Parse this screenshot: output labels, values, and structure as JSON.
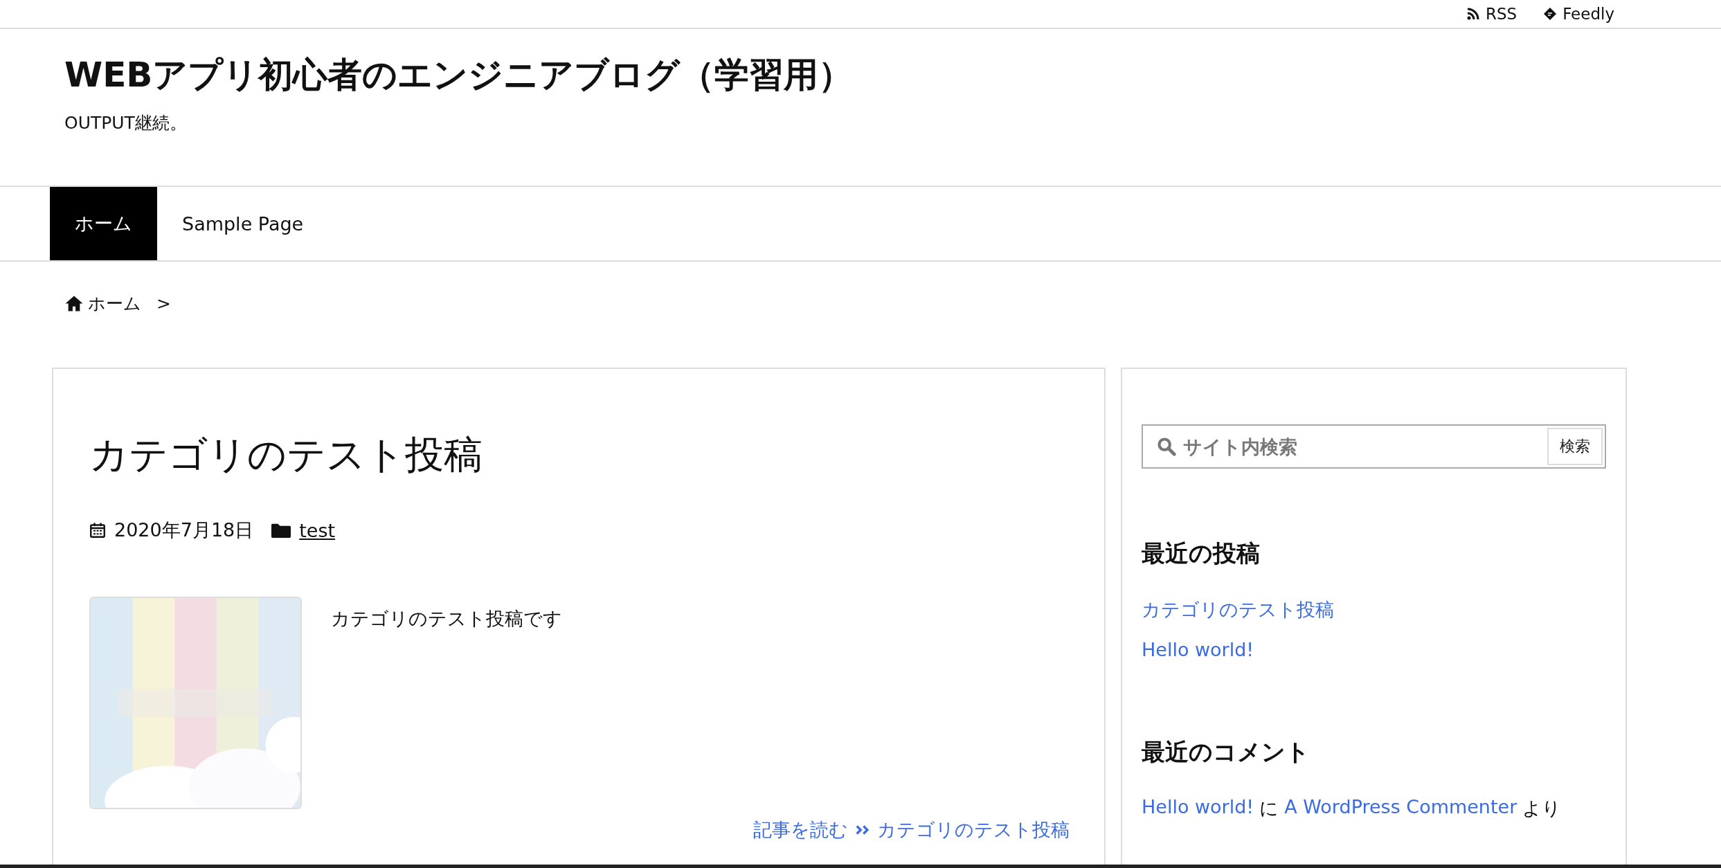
{
  "top_links": [
    {
      "kind": "rss",
      "label": "RSS"
    },
    {
      "kind": "feedly",
      "label": "Feedly"
    }
  ],
  "site": {
    "title": "WEBアプリ初心者のエンジニアブログ（学習用）",
    "tagline": "OUTPUT継続。"
  },
  "nav": [
    {
      "label": "ホーム",
      "selected": true
    },
    {
      "label": "Sample Page",
      "selected": false
    }
  ],
  "breadcrumb": {
    "home": "ホーム",
    "separator": ">"
  },
  "post": {
    "title": "カテゴリのテスト投稿",
    "date": "2020年7月18日",
    "category": "test",
    "excerpt": "カテゴリのテスト投稿です",
    "read_more": {
      "label": "記事を読む",
      "link": "カテゴリのテスト投稿"
    }
  },
  "sidebar": {
    "search": {
      "placeholder": "サイト内検索",
      "button": "検索"
    },
    "widgets": [
      {
        "kind": "posts",
        "title": "最近の投稿",
        "links": [
          "カテゴリのテスト投稿",
          "Hello world!"
        ]
      },
      {
        "kind": "comments",
        "title": "最近のコメント",
        "comments": [
          {
            "post": "Hello world!",
            "joiner": "に",
            "author": "A WordPress Commenter",
            "suffix": "より"
          }
        ]
      }
    ]
  }
}
